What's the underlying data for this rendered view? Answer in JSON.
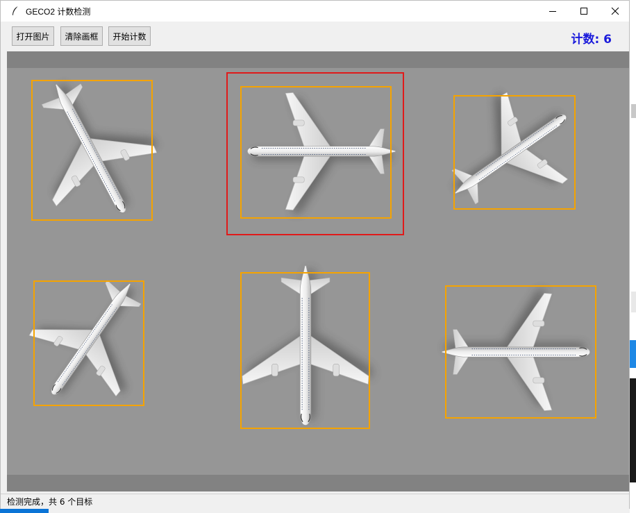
{
  "window": {
    "title": "GECO2 计数检测",
    "controls": [
      "minimize-icon",
      "maximize-icon",
      "close-icon"
    ]
  },
  "toolbar": {
    "open_image": "打开图片",
    "clear_boxes": "清除画框",
    "start_count": "开始计数"
  },
  "count": {
    "label": "计数",
    "value": "6",
    "display": "计数: 6",
    "color": "#1a1adb"
  },
  "status": {
    "text": "检测完成，共 6 个目标"
  },
  "canvas": {
    "background": "#969696",
    "band_color": "#828282",
    "detections": 6,
    "detection_box_color": "#f5a300",
    "user_box_color": "#e01a1a"
  }
}
